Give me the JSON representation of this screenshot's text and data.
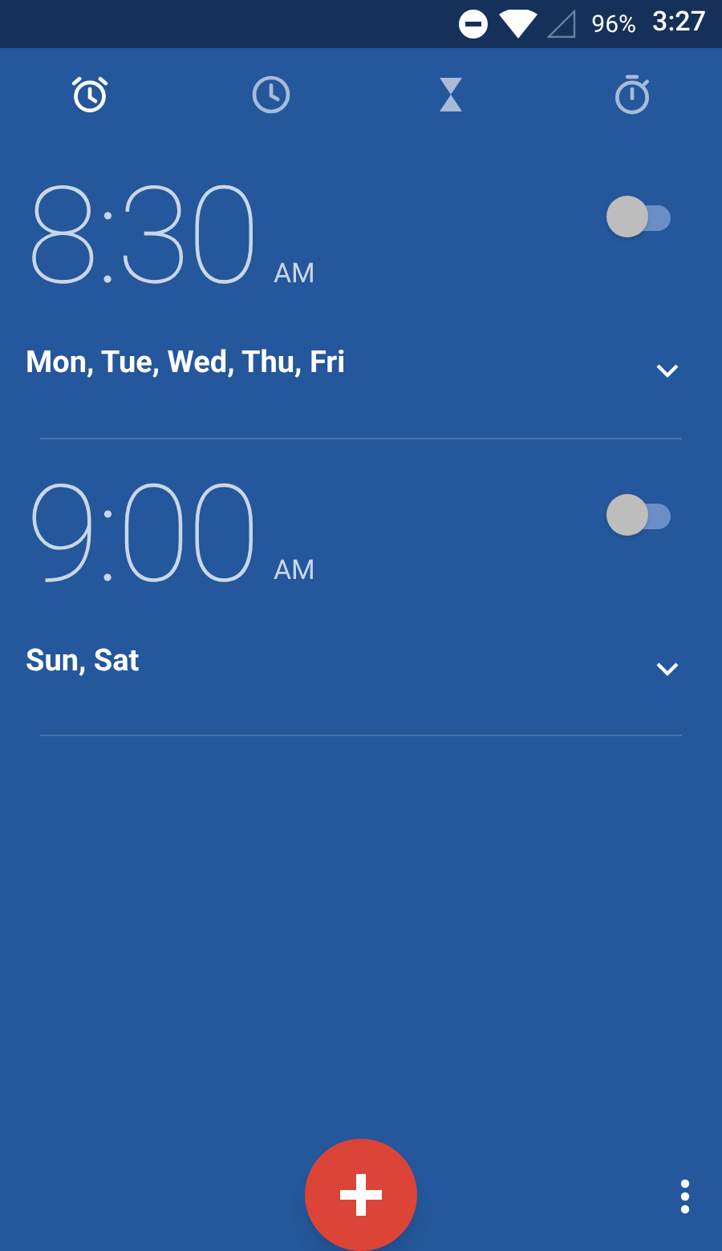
{
  "status_bar": {
    "battery": "96%",
    "time": "3:27"
  },
  "tabs": [
    {
      "kind": "alarm",
      "selected": true
    },
    {
      "kind": "clock",
      "selected": false
    },
    {
      "kind": "timer",
      "selected": false
    },
    {
      "kind": "stopwatch",
      "selected": false
    }
  ],
  "alarms": [
    {
      "time": "8:30",
      "meridiem": "AM",
      "days": "Mon, Tue, Wed, Thu, Fri",
      "on": false,
      "expanded": false
    },
    {
      "time": "9:00",
      "meridiem": "AM",
      "days": "Sun, Sat",
      "on": false,
      "expanded": false
    }
  ]
}
